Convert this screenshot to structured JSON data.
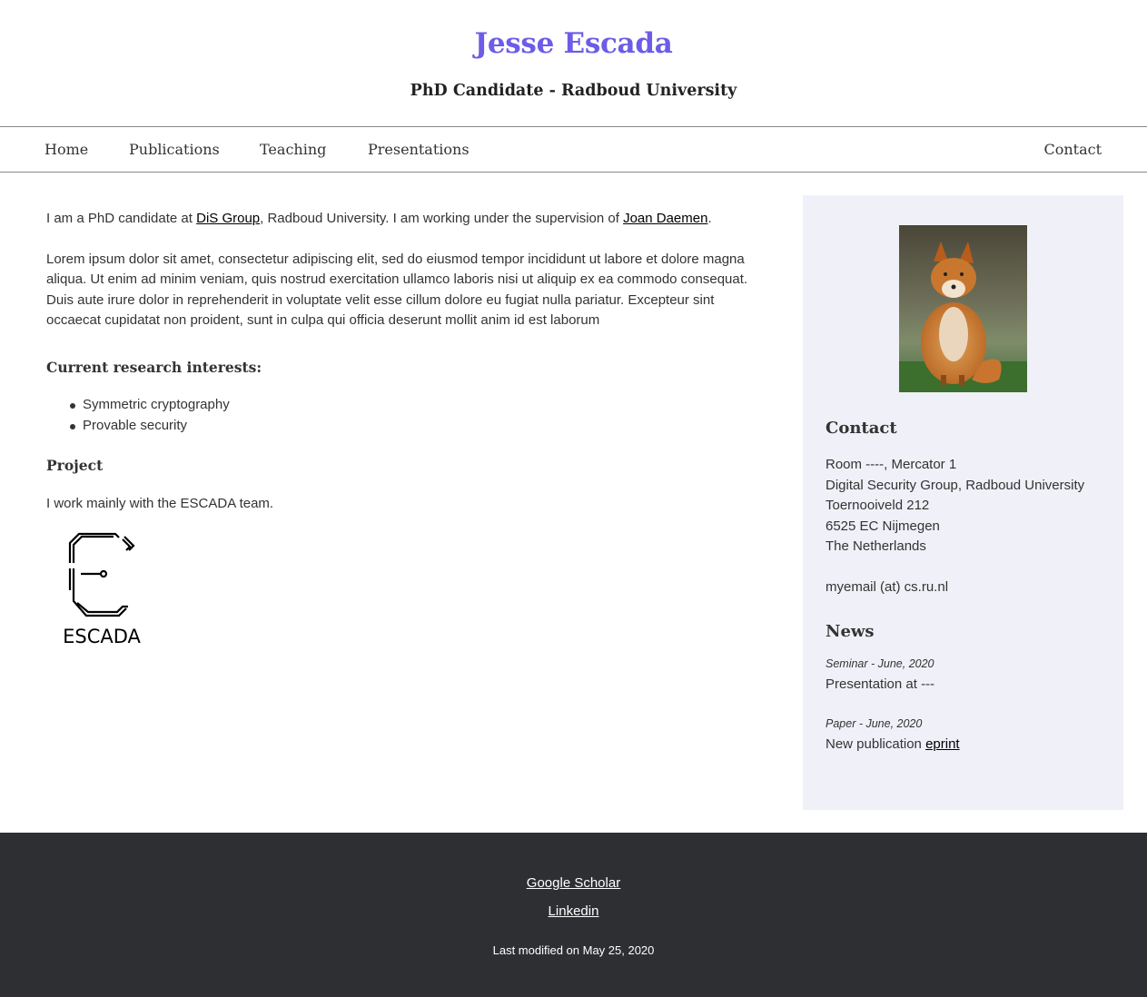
{
  "header": {
    "title": "Jesse Escada",
    "subtitle": "PhD Candidate - Radboud University",
    "title_color": "#6c5ce7"
  },
  "nav": {
    "items": [
      "Home",
      "Publications",
      "Teaching",
      "Presentations"
    ],
    "contact": "Contact"
  },
  "main": {
    "intro_prefix": "I am a PhD candidate at ",
    "intro_group_link": "DiS Group",
    "intro_mid": ", Radboud University. I am working under the supervision of ",
    "intro_supervisor_link": "Joan Daemen",
    "intro_suffix": ".",
    "lorem": "Lorem ipsum dolor sit amet, consectetur adipiscing elit, sed do eiusmod tempor incididunt ut labore et dolore magna aliqua. Ut enim ad minim veniam, quis nostrud exercitation ullamco laboris nisi ut aliquip ex ea commodo consequat. Duis aute irure dolor in reprehenderit in voluptate velit esse cillum dolore eu fugiat nulla pariatur. Excepteur sint occaecat cupidatat non proident, sunt in culpa qui officia deserunt mollit anim id est laborum",
    "interests_heading": "Current research interests:",
    "interests": [
      "Symmetric cryptography",
      "Provable security"
    ],
    "project_heading": "Project",
    "project_text": "I work mainly with the ESCADA team.",
    "logo_text": "ESCADA"
  },
  "sidebar": {
    "background": "#f0f0f8",
    "contact_heading": "Contact",
    "address_lines": [
      "Room ----, Mercator 1",
      "Digital Security Group, Radboud University",
      "Toernooiveld 212",
      "6525 EC Nijmegen",
      "The Netherlands"
    ],
    "email": "myemail (at) cs.ru.nl",
    "news_heading": "News",
    "news": [
      {
        "meta": "Seminar - June, 2020",
        "text": "Presentation at ---",
        "link": ""
      },
      {
        "meta": "Paper - June, 2020",
        "text": "New publication ",
        "link": "eprint"
      }
    ]
  },
  "footer": {
    "links": [
      "Google Scholar",
      "Linkedin"
    ],
    "modified": "Last modified on May 25, 2020",
    "background": "#2e2f33"
  }
}
